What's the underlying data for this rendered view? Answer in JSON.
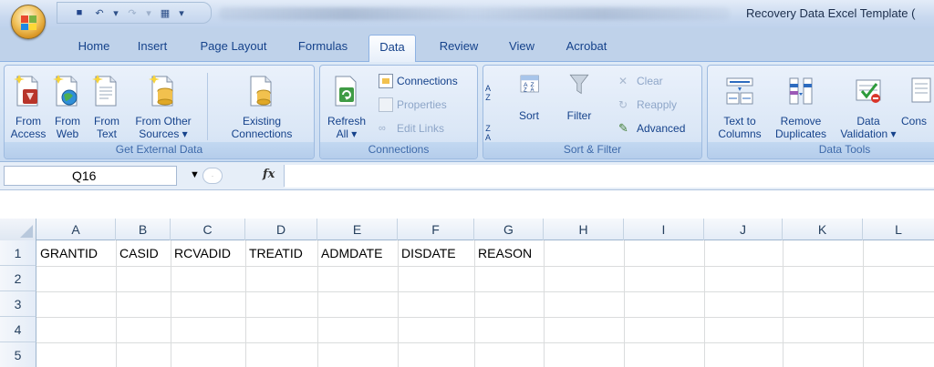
{
  "window": {
    "title": "Recovery Data Excel Template ("
  },
  "quick_access": {
    "save_glyph": "■",
    "undo_glyph": "↶",
    "undo_drop": "▾",
    "redo_glyph": "↷",
    "redo_drop": "▾",
    "custom_glyph": "▦",
    "customize_glyph": "▾"
  },
  "tabs": [
    "Home",
    "Insert",
    "Page Layout",
    "Formulas",
    "Data",
    "Review",
    "View",
    "Acrobat"
  ],
  "active_tab": "Data",
  "ribbon": {
    "get_external_data": {
      "label": "Get External Data",
      "from_access": [
        "From",
        "Access"
      ],
      "from_web": [
        "From",
        "Web"
      ],
      "from_text": [
        "From",
        "Text"
      ],
      "from_other_sources": [
        "From Other",
        "Sources ▾"
      ],
      "existing_connections": [
        "Existing",
        "Connections"
      ]
    },
    "connections": {
      "label": "Connections",
      "refresh_all": [
        "Refresh",
        "All ▾"
      ],
      "connections": "Connections",
      "properties": "Properties",
      "edit_links": "Edit Links"
    },
    "sort_filter": {
      "label": "Sort & Filter",
      "sort": "Sort",
      "filter": "Filter",
      "clear": "Clear",
      "reapply": "Reapply",
      "advanced": "Advanced",
      "az_top": "A",
      "az_bottom": "Z"
    },
    "data_tools": {
      "label": "Data Tools",
      "text_to_columns": [
        "Text to",
        "Columns"
      ],
      "remove_duplicates": [
        "Remove",
        "Duplicates"
      ],
      "data_validation": [
        "Data",
        "Validation ▾"
      ],
      "consolidate": "Cons"
    }
  },
  "formula_bar": {
    "name_box": "Q16",
    "name_box_arrow": "▼",
    "fx": "fx",
    "formula": ""
  },
  "sheet": {
    "columns": [
      "A",
      "B",
      "C",
      "D",
      "E",
      "F",
      "G",
      "H",
      "I",
      "J",
      "K",
      "L"
    ],
    "rows": [
      "1",
      "2",
      "3",
      "4",
      "5"
    ],
    "row1": [
      "GRANTID",
      "CASID",
      "RCVADID",
      "TREATID",
      "ADMDATE",
      "DISDATE",
      "REASON"
    ]
  },
  "colors": {
    "ribbon_bg": "#d3e2f4",
    "tab_text": "#15428b",
    "group_label": "#3e6aaa",
    "grid_line": "#dadcdd"
  }
}
